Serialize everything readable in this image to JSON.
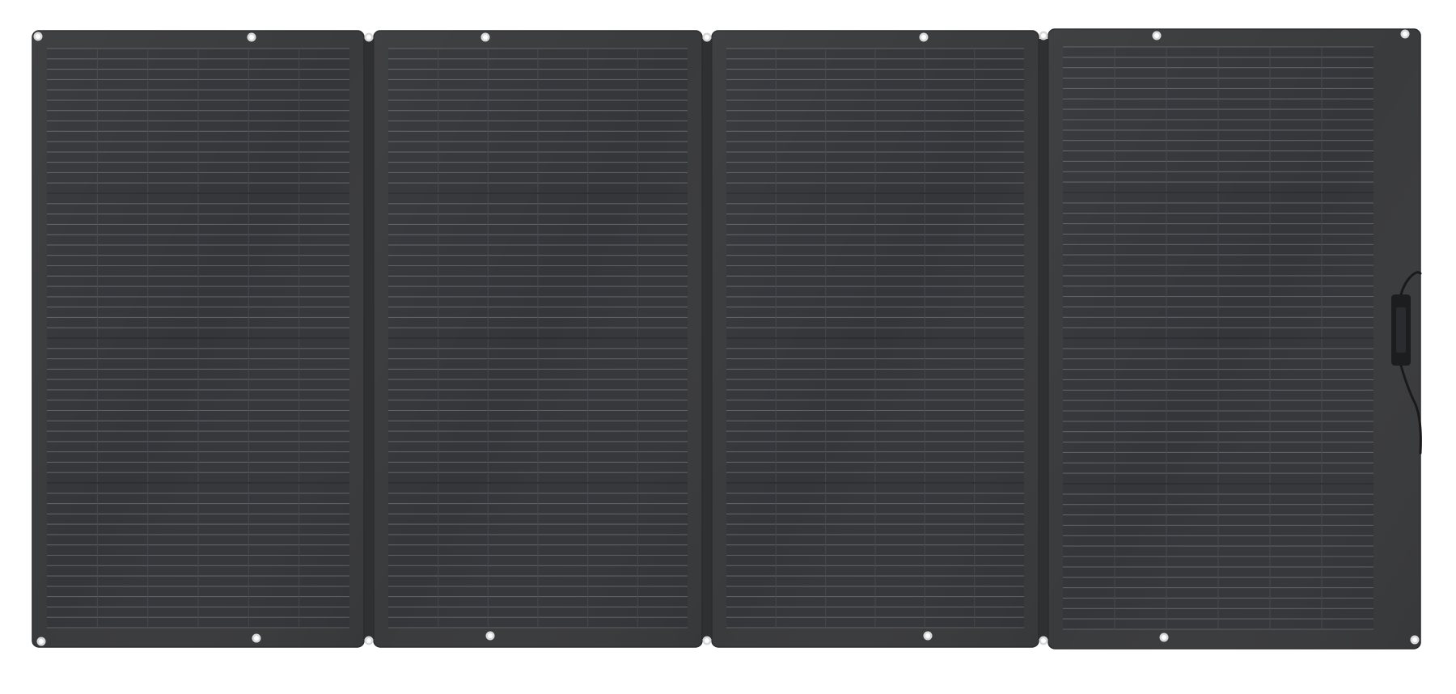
{
  "scene": {
    "subject": "solar-panel",
    "panel_count": 4,
    "colors": {
      "background": "#ffffff",
      "frame": "#3a3b3d",
      "frame_edge": "#2b2c2e",
      "cell_area": "#34363a",
      "cell_line": "#5d6064",
      "cell_line_minor": "#44474b",
      "grommet_ring": "#d8d8d8",
      "grommet_hole": "#ffffff",
      "junction_box": "#1c1d1f",
      "cable": "#1a1a1b"
    },
    "icons": [
      "grommet-icon",
      "junction-box-icon",
      "cable-icon"
    ]
  }
}
